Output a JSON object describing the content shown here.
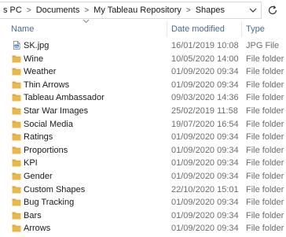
{
  "address": {
    "crumbs": [
      "s PC",
      "Documents",
      "My Tableau Repository",
      "Shapes"
    ]
  },
  "columns": {
    "name": "Name",
    "date": "Date modified",
    "type": "Type"
  },
  "rows": [
    {
      "name": "SK.jpg",
      "date": "16/01/2019 10:08",
      "type": "JPG File",
      "icon": "jpg-file-icon"
    },
    {
      "name": "Wine",
      "date": "10/05/2020 14:00",
      "type": "File folder",
      "icon": "folder-icon"
    },
    {
      "name": "Weather",
      "date": "01/09/2020 09:34",
      "type": "File folder",
      "icon": "folder-icon"
    },
    {
      "name": "Thin Arrows",
      "date": "01/09/2020 09:34",
      "type": "File folder",
      "icon": "folder-icon"
    },
    {
      "name": "Tableau Ambassador",
      "date": "09/03/2020 14:36",
      "type": "File folder",
      "icon": "folder-icon"
    },
    {
      "name": "Star War Images",
      "date": "25/02/2019 11:58",
      "type": "File folder",
      "icon": "folder-icon"
    },
    {
      "name": "Social Media",
      "date": "19/07/2020 16:54",
      "type": "File folder",
      "icon": "folder-icon"
    },
    {
      "name": "Ratings",
      "date": "01/09/2020 09:34",
      "type": "File folder",
      "icon": "folder-icon"
    },
    {
      "name": "Proportions",
      "date": "01/09/2020 09:34",
      "type": "File folder",
      "icon": "folder-icon"
    },
    {
      "name": "KPI",
      "date": "01/09/2020 09:34",
      "type": "File folder",
      "icon": "folder-icon"
    },
    {
      "name": "Gender",
      "date": "01/09/2020 09:34",
      "type": "File folder",
      "icon": "folder-icon"
    },
    {
      "name": "Custom Shapes",
      "date": "22/10/2020 15:01",
      "type": "File folder",
      "icon": "folder-icon"
    },
    {
      "name": "Bug Tracking",
      "date": "01/09/2020 09:34",
      "type": "File folder",
      "icon": "folder-icon"
    },
    {
      "name": "Bars",
      "date": "01/09/2020 09:34",
      "type": "File folder",
      "icon": "folder-icon"
    },
    {
      "name": "Arrows",
      "date": "01/09/2020 09:34",
      "type": "File folder",
      "icon": "folder-icon"
    }
  ],
  "colors": {
    "folder": "#e8b94a",
    "header_text": "#4d6a8a",
    "secondary_text": "#6d6d6d"
  }
}
